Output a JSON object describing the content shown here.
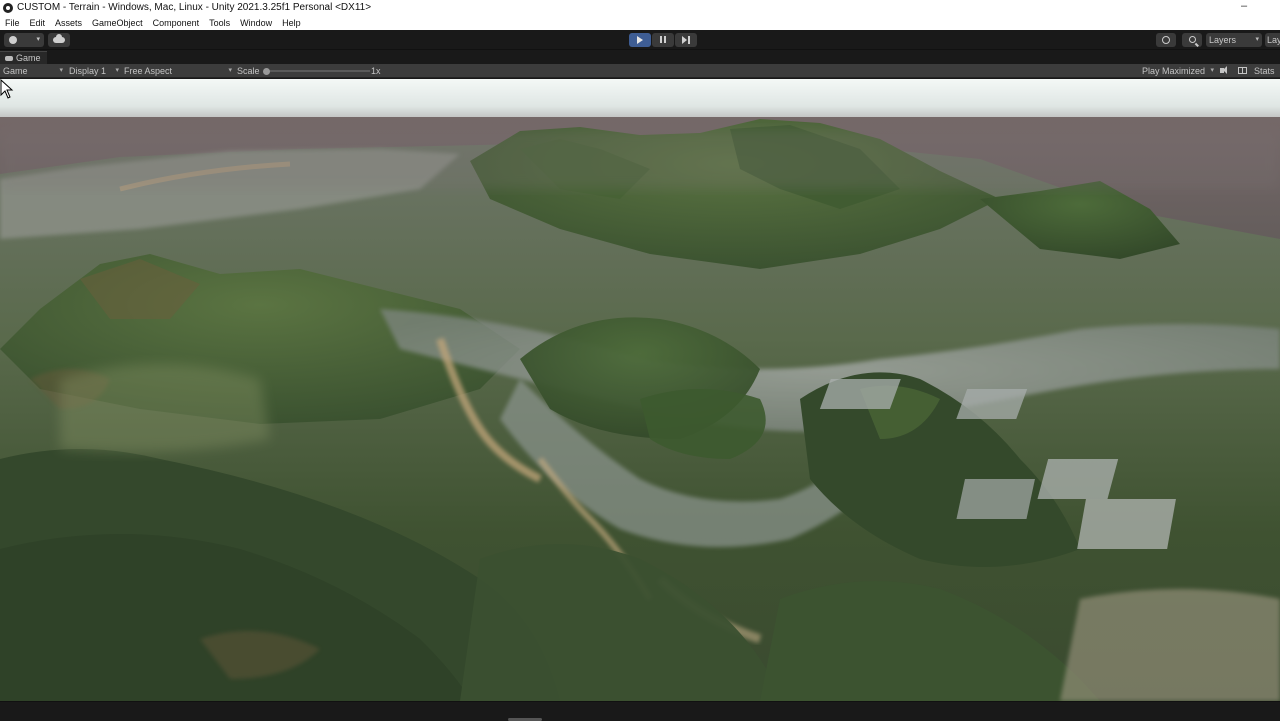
{
  "window": {
    "title": "CUSTOM - Terrain - Windows, Mac, Linux - Unity 2021.3.25f1 Personal <DX11>",
    "minimize_glyph": "–"
  },
  "menu": {
    "items": [
      "File",
      "Edit",
      "Assets",
      "GameObject",
      "Component",
      "Tools",
      "Window",
      "Help"
    ]
  },
  "toolbar": {
    "account_icon": "account-icon",
    "cloud_icon": "cloud-icon",
    "play_icon": "play-icon",
    "pause_icon": "pause-icon",
    "step_icon": "step-icon",
    "history_icon": "history-icon",
    "search_icon": "search-icon",
    "layers_label": "Layers",
    "layout_label": "Lay",
    "play_active_color": "#3e5d94"
  },
  "tab": {
    "label": "Game"
  },
  "game_toolbar": {
    "mode": "Game",
    "display": "Display 1",
    "aspect": "Free Aspect",
    "scale_label": "Scale",
    "scale_value": "1x",
    "play_mode": "Play Maximized",
    "stats_label": "Stats"
  },
  "viewport": {
    "scene": "aerial terrain with satellite-textured mountains, valleys and urban areas",
    "sky_color": "#e9efee",
    "haze_color": "#6e6164",
    "terrain_colors": [
      "#3f5a33",
      "#556b3d",
      "#7a7f6e",
      "#9a9f94",
      "#b59a72"
    ]
  }
}
